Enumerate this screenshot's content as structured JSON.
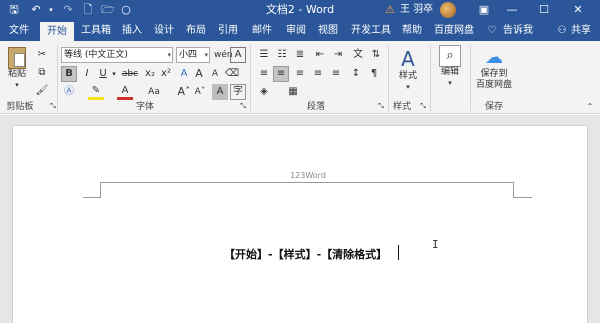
{
  "titlebar": {
    "title": "文档2 - Word",
    "user": "王 羽卒",
    "icons": {
      "save": "save-icon",
      "undo": "undo-icon",
      "redo": "redo-icon",
      "new": "new-document-icon",
      "open": "open-folder-icon",
      "circle": "circle-icon",
      "warning": "warning-icon",
      "ribbon_display": "ribbon-display-icon",
      "minimize": "minimize-icon",
      "maximize": "maximize-icon",
      "close": "close-icon"
    },
    "glyphs": {
      "save": "🖫",
      "undo": "↶",
      "redo": "↷",
      "new": "🗋",
      "open": "🗁",
      "circle": "○",
      "warning": "⚠",
      "ribbon": "▣",
      "min": "—",
      "max": "☐",
      "close": "✕"
    }
  },
  "tabs": [
    "文件",
    "开始",
    "工具箱",
    "插入",
    "设计",
    "布局",
    "引用",
    "邮件",
    "审阅",
    "视图",
    "开发工具",
    "帮助",
    "百度网盘"
  ],
  "active_tab": "开始",
  "tell_me": "告诉我",
  "share": "共享",
  "ribbon": {
    "clipboard": {
      "label": "剪贴板",
      "paste": "粘贴"
    },
    "font": {
      "label": "字体",
      "font_name": "等线 (中文正文)",
      "font_size": "小四",
      "bold": "B",
      "italic": "I",
      "underline": "U",
      "strike": "abc",
      "subscript": "x₂",
      "superscript": "x²",
      "clear": "A",
      "grow": "A",
      "shrink": "A",
      "case": "Aa",
      "wen": "wén",
      "char_border": "A",
      "char_shade": "A"
    },
    "paragraph": {
      "label": "段落"
    },
    "styles": {
      "label": "样式",
      "button": "样式"
    },
    "editing": {
      "button": "编辑"
    },
    "save": {
      "label": "保存",
      "button_line1": "保存到",
      "button_line2": "百度网盘"
    }
  },
  "document": {
    "header": "123Word",
    "body": "【开始】-【样式】-【清除格式】"
  }
}
